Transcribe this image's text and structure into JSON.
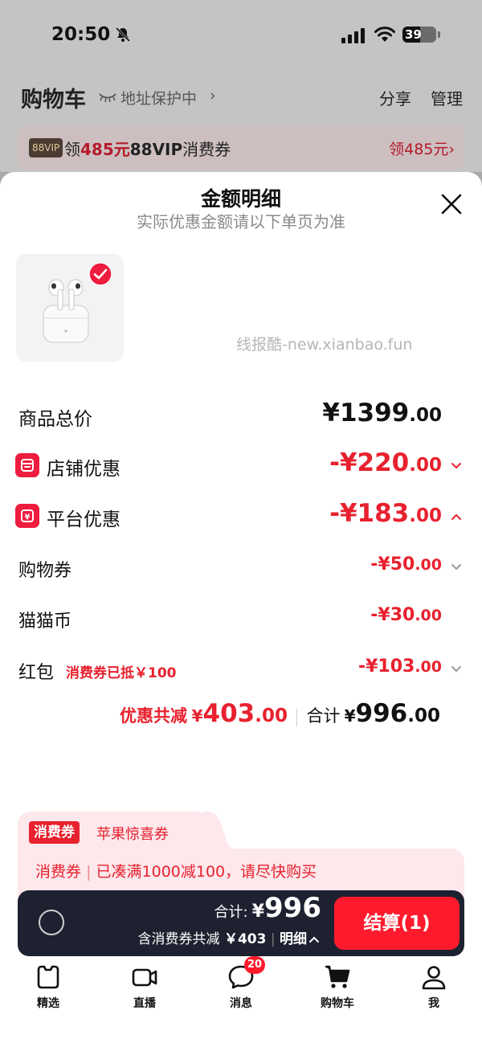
{
  "status_bar": {
    "time": "20:50",
    "battery": "39"
  },
  "cart_header": {
    "title": "购物车",
    "address_protect": "地址保护中",
    "share": "分享",
    "manage": "管理"
  },
  "vip_banner": {
    "badge": "88VIP",
    "prefix": "领",
    "amount": "485元",
    "vip_label": "88VIP",
    "suffix": "消费券",
    "right": "领485元"
  },
  "sheet": {
    "title": "金额明细",
    "subtitle": "实际优惠金额请以下单页为准",
    "watermark": "线报酷-new.xianbao.fun"
  },
  "breakdown": {
    "total_price": {
      "label": "商品总价",
      "currency": "¥",
      "integer": "1399",
      "decimal": ".00"
    },
    "store_discount": {
      "label": "店铺优惠",
      "prefix": "-¥",
      "integer": "220",
      "decimal": ".00"
    },
    "platform_discount": {
      "label": "平台优惠",
      "prefix": "-¥",
      "integer": "183",
      "decimal": ".00"
    },
    "shopping_voucher": {
      "label": "购物券",
      "prefix": "-¥",
      "integer": "50",
      "decimal": ".00"
    },
    "cat_coin": {
      "label": "猫猫币",
      "prefix": "-¥",
      "integer": "30",
      "decimal": ".00"
    },
    "red_packet": {
      "label": "红包",
      "note": "消费券已抵￥100",
      "prefix": "-¥",
      "integer": "103",
      "decimal": ".00"
    }
  },
  "summary": {
    "discount_label": "优惠共减",
    "discount_currency": "¥",
    "discount_integer": "403",
    "discount_decimal": ".00",
    "total_label": "合计",
    "total_currency": "¥",
    "total_integer": "996",
    "total_decimal": ".00"
  },
  "coupon": {
    "badge": "消费券",
    "tab_title": "苹果惊喜券",
    "line_label": "消费券",
    "line_text": "已凑满1000减100，请尽快购买"
  },
  "checkout": {
    "total_label": "合计:",
    "currency": "¥",
    "amount": "996",
    "detail_prefix": "含消费券共减",
    "detail_amount": "￥403",
    "detail_link": "明细",
    "settle_label": "结算(1)"
  },
  "tabbar": {
    "items": [
      {
        "label": "精选",
        "icon": "featured-icon"
      },
      {
        "label": "直播",
        "icon": "live-icon"
      },
      {
        "label": "消息",
        "icon": "message-icon",
        "badge": "20"
      },
      {
        "label": "购物车",
        "icon": "cart-icon"
      },
      {
        "label": "我",
        "icon": "profile-icon"
      }
    ]
  },
  "colors": {
    "accent_red": "#e8212e",
    "settle_button": "#ff1b2d",
    "checkout_bar": "#1e2230",
    "coupon_bg": "#fde8ec"
  }
}
